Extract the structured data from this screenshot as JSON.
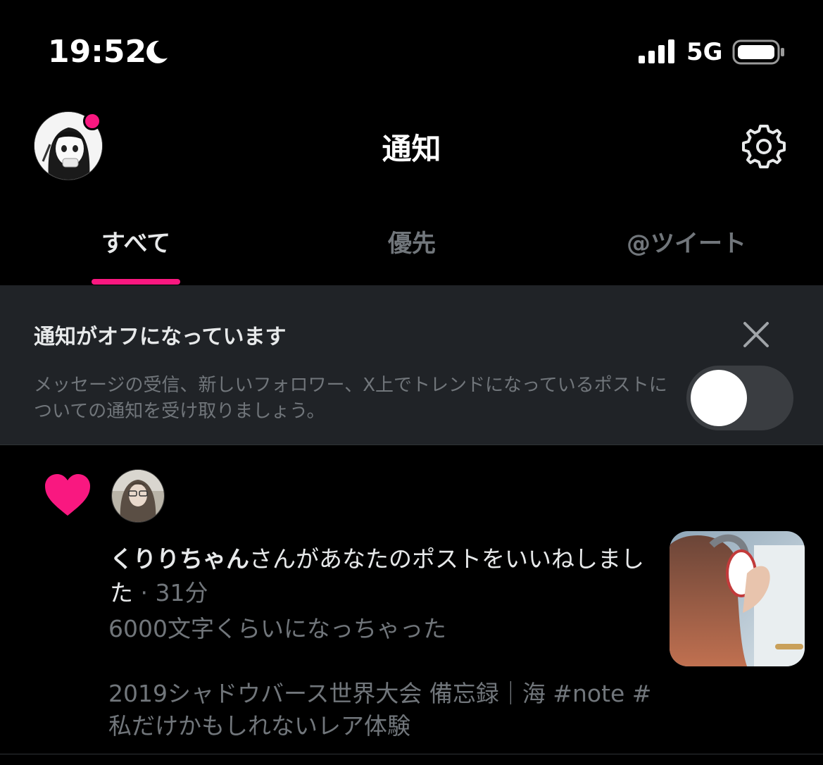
{
  "status_bar": {
    "time": "19:52",
    "network": "5G",
    "icons": [
      "moon-icon",
      "signal-icon",
      "battery-icon"
    ]
  },
  "header": {
    "title": "通知",
    "avatar_icon": "avatar",
    "settings_icon": "gear-icon"
  },
  "tabs": [
    {
      "label": "すべて",
      "active": true
    },
    {
      "label": "優先",
      "active": false
    },
    {
      "label": "@ツイート",
      "active": false
    }
  ],
  "banner": {
    "title": "通知がオフになっています",
    "body": "メッセージの受信、新しいフォロワー、X上でトレンドになっているポストについての通知を受け取りましょう。",
    "toggle_on": false
  },
  "notification": {
    "type_icon": "heart-icon",
    "user": "くりりちゃん",
    "action": "さんがあなたのポストをいいねしました",
    "time": "31分",
    "excerpt": "6000文字くらいになっちゃった\n\n2019シャドウバース世界大会 備忘録｜海 #note #私だけかもしれないレア体験"
  },
  "colors": {
    "accent": "#f91880",
    "background": "#000000",
    "banner_bg": "#202327",
    "muted_text": "#71767b",
    "primary_text": "#e7e9ea"
  }
}
